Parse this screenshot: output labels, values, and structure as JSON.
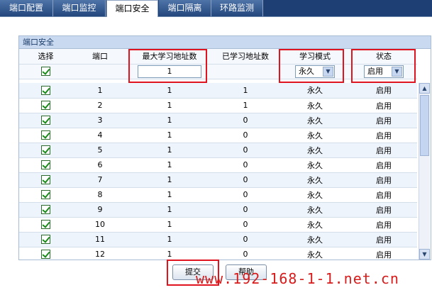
{
  "tabs": [
    {
      "label": "端口配置",
      "active": false
    },
    {
      "label": "端口监控",
      "active": false
    },
    {
      "label": "端口安全",
      "active": true
    },
    {
      "label": "端口隔离",
      "active": false
    },
    {
      "label": "环路监测",
      "active": false
    }
  ],
  "panel_title": "端口安全",
  "headers": {
    "select": "选择",
    "port": "端口",
    "max_learn": "最大学习地址数",
    "learned": "已学习地址数",
    "mode": "学习模式",
    "status": "状态"
  },
  "controls": {
    "max_learn_value": "1",
    "mode_value": "永久",
    "status_value": "启用"
  },
  "rows": [
    {
      "port": "1",
      "max": "1",
      "learned": "1",
      "mode": "永久",
      "status": "启用"
    },
    {
      "port": "2",
      "max": "1",
      "learned": "1",
      "mode": "永久",
      "status": "启用"
    },
    {
      "port": "3",
      "max": "1",
      "learned": "0",
      "mode": "永久",
      "status": "启用"
    },
    {
      "port": "4",
      "max": "1",
      "learned": "0",
      "mode": "永久",
      "status": "启用"
    },
    {
      "port": "5",
      "max": "1",
      "learned": "0",
      "mode": "永久",
      "status": "启用"
    },
    {
      "port": "6",
      "max": "1",
      "learned": "0",
      "mode": "永久",
      "status": "启用"
    },
    {
      "port": "7",
      "max": "1",
      "learned": "0",
      "mode": "永久",
      "status": "启用"
    },
    {
      "port": "8",
      "max": "1",
      "learned": "0",
      "mode": "永久",
      "status": "启用"
    },
    {
      "port": "9",
      "max": "1",
      "learned": "0",
      "mode": "永久",
      "status": "启用"
    },
    {
      "port": "10",
      "max": "1",
      "learned": "0",
      "mode": "永久",
      "status": "启用"
    },
    {
      "port": "11",
      "max": "1",
      "learned": "0",
      "mode": "永久",
      "status": "启用"
    },
    {
      "port": "12",
      "max": "1",
      "learned": "0",
      "mode": "永久",
      "status": "启用"
    }
  ],
  "buttons": {
    "submit": "提交",
    "help": "帮助"
  },
  "watermark": "www.192-168-1-1.net.cn",
  "colors": {
    "tabbar": "#1d3f73",
    "highlight": "#e0141e",
    "panel_header": "#c9d9ef"
  }
}
